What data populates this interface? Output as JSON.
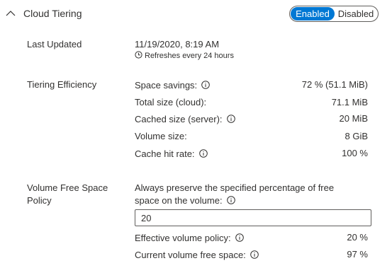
{
  "section": {
    "title": "Cloud Tiering",
    "toggle": {
      "enabled_label": "Enabled",
      "disabled_label": "Disabled",
      "selected": "Enabled"
    }
  },
  "last_updated": {
    "label": "Last Updated",
    "value": "11/19/2020, 8:19 AM",
    "refresh_note": "Refreshes every 24 hours"
  },
  "tiering_efficiency": {
    "label": "Tiering Efficiency",
    "rows": [
      {
        "name": "Space savings:",
        "value": "72 % (51.1 MiB)",
        "info": true
      },
      {
        "name": "Total size (cloud):",
        "value": "71.1 MiB",
        "info": false
      },
      {
        "name": "Cached size (server):",
        "value": "20 MiB",
        "info": true
      },
      {
        "name": "Volume size:",
        "value": "8 GiB",
        "info": false
      },
      {
        "name": "Cache hit rate:",
        "value": "100 %",
        "info": true
      }
    ]
  },
  "volume_free_space": {
    "label_line1": "Volume Free Space",
    "label_line2": "Policy",
    "description_line1": "Always preserve the specified percentage of free",
    "description_line2": "space on the volume:",
    "input_value": "20",
    "rows": [
      {
        "name": "Effective volume policy:",
        "value": "20 %",
        "info": true
      },
      {
        "name": "Current volume free space:",
        "value": "97 %",
        "info": true
      }
    ]
  },
  "colors": {
    "accent": "#0078d4",
    "text": "#323130",
    "border": "#605e5c"
  },
  "icons": {
    "collapse": "chevron-up-icon",
    "info": "info-icon",
    "clock": "clock-icon"
  }
}
